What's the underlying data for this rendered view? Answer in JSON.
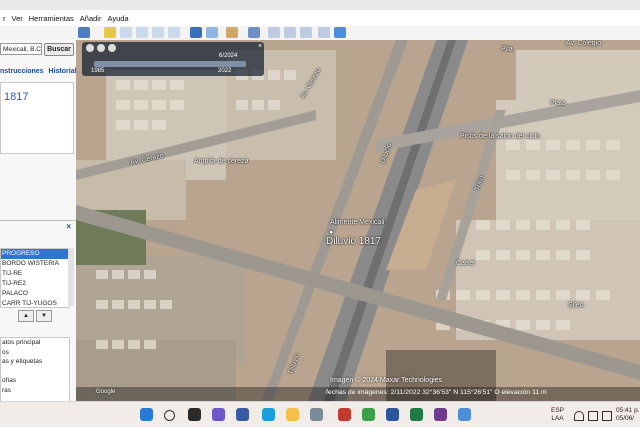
{
  "menu": [
    "r",
    "Ver",
    "Herramientas",
    "Añadir",
    "Ayuda"
  ],
  "search": {
    "value": "Mexicali, B.C.",
    "button_label": "Buscar"
  },
  "sidebar": {
    "tabs": [
      "nstrucciones",
      "Historial"
    ],
    "result_title": "1817",
    "places_close": "×",
    "places": [
      "PROGRESO",
      "BORDO WISTERIA",
      "TIJ-RE",
      "TIJ-RE2",
      "PALACO",
      "CARR TIJ-YUGOS"
    ],
    "nav_up": "▲",
    "nav_down": "▼",
    "layers": [
      "atos principal",
      "os",
      "as y etiquetas",
      "",
      "ofías",
      "ras"
    ]
  },
  "time_slider": {
    "date": "6/2024",
    "start_year": "1985",
    "end_year": "2022",
    "close": "×"
  },
  "map_labels": {
    "dilucio_main": "Diluvio 1817",
    "alimente": "Alimente Mexicali",
    "cereza": "Ampita de cereza",
    "salon": "Pisos de la salon del ciclo",
    "pin_top": "Pila",
    "road_dilucio": "Dilucio",
    "road_dilucio2": "Diluvio",
    "road_lascap": "Av. Cerezo",
    "road_alcerez": "Av. Cerezo",
    "road_tritio": "Trítio",
    "road_plata": "Plata",
    "road_sileo": "Sileo",
    "road_top": "Av. Colegio",
    "road_top2": "Cartel"
  },
  "copyright": "Imagen © 2024 Maxar Technologies",
  "status": "fechas de imágenes: 2/11/2022   32°36'53\" N 115°26'51\" O   elevación 11 m",
  "google_mark": "Google",
  "tray": {
    "lang1": "ESP",
    "lang2": "LAA",
    "time": "05:41 p.",
    "date": "05/06/"
  },
  "colors": {
    "selection": "#2f74d0",
    "tab_text": "#1a4ea0",
    "map_soil": "#b8a48e"
  }
}
